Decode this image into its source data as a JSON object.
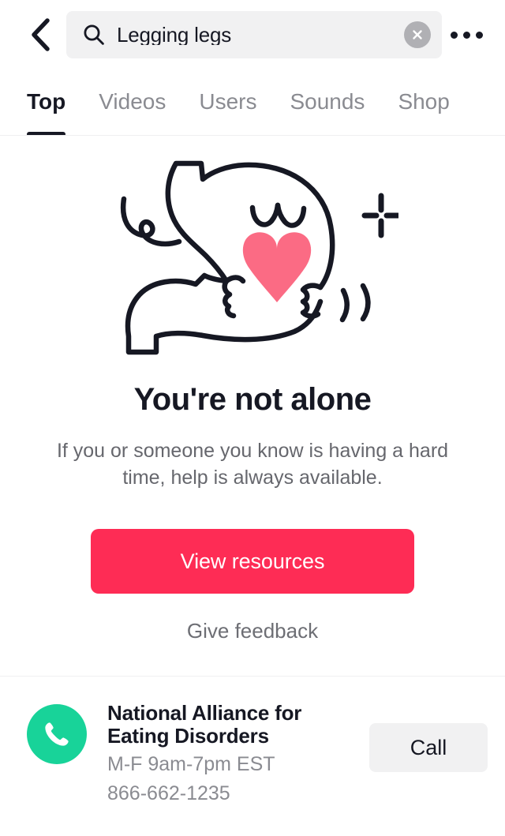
{
  "header": {
    "back_icon": "chevron-left-icon",
    "more_icon": "ellipsis-icon",
    "search": {
      "icon": "search-icon",
      "value": "Legging legs",
      "placeholder": "Search",
      "clear_icon": "close-circle-icon"
    }
  },
  "tabs": [
    {
      "label": "Top",
      "active": true
    },
    {
      "label": "Videos",
      "active": false
    },
    {
      "label": "Users",
      "active": false
    },
    {
      "label": "Sounds",
      "active": false
    },
    {
      "label": "Shop",
      "active": false
    }
  ],
  "illustration": {
    "name": "character-hugging-heart-illustration",
    "heart_color": "#fb6b84",
    "line_color": "#161823"
  },
  "main": {
    "headline": "You're not alone",
    "subhead": "If you or someone you know is having a hard time, help is always available.",
    "primary_action": "View resources",
    "secondary_action": "Give feedback"
  },
  "resource": {
    "phone_icon": "phone-icon",
    "badge_color": "#18d399",
    "name": "National Alliance for Eating Disorders",
    "hours": "M-F 9am-7pm EST",
    "phone": "866-662-1235",
    "call_label": "Call"
  },
  "colors": {
    "accent_red": "#fe2c55",
    "text_primary": "#161823",
    "text_secondary": "#8a8b91",
    "surface": "#f1f1f2"
  }
}
